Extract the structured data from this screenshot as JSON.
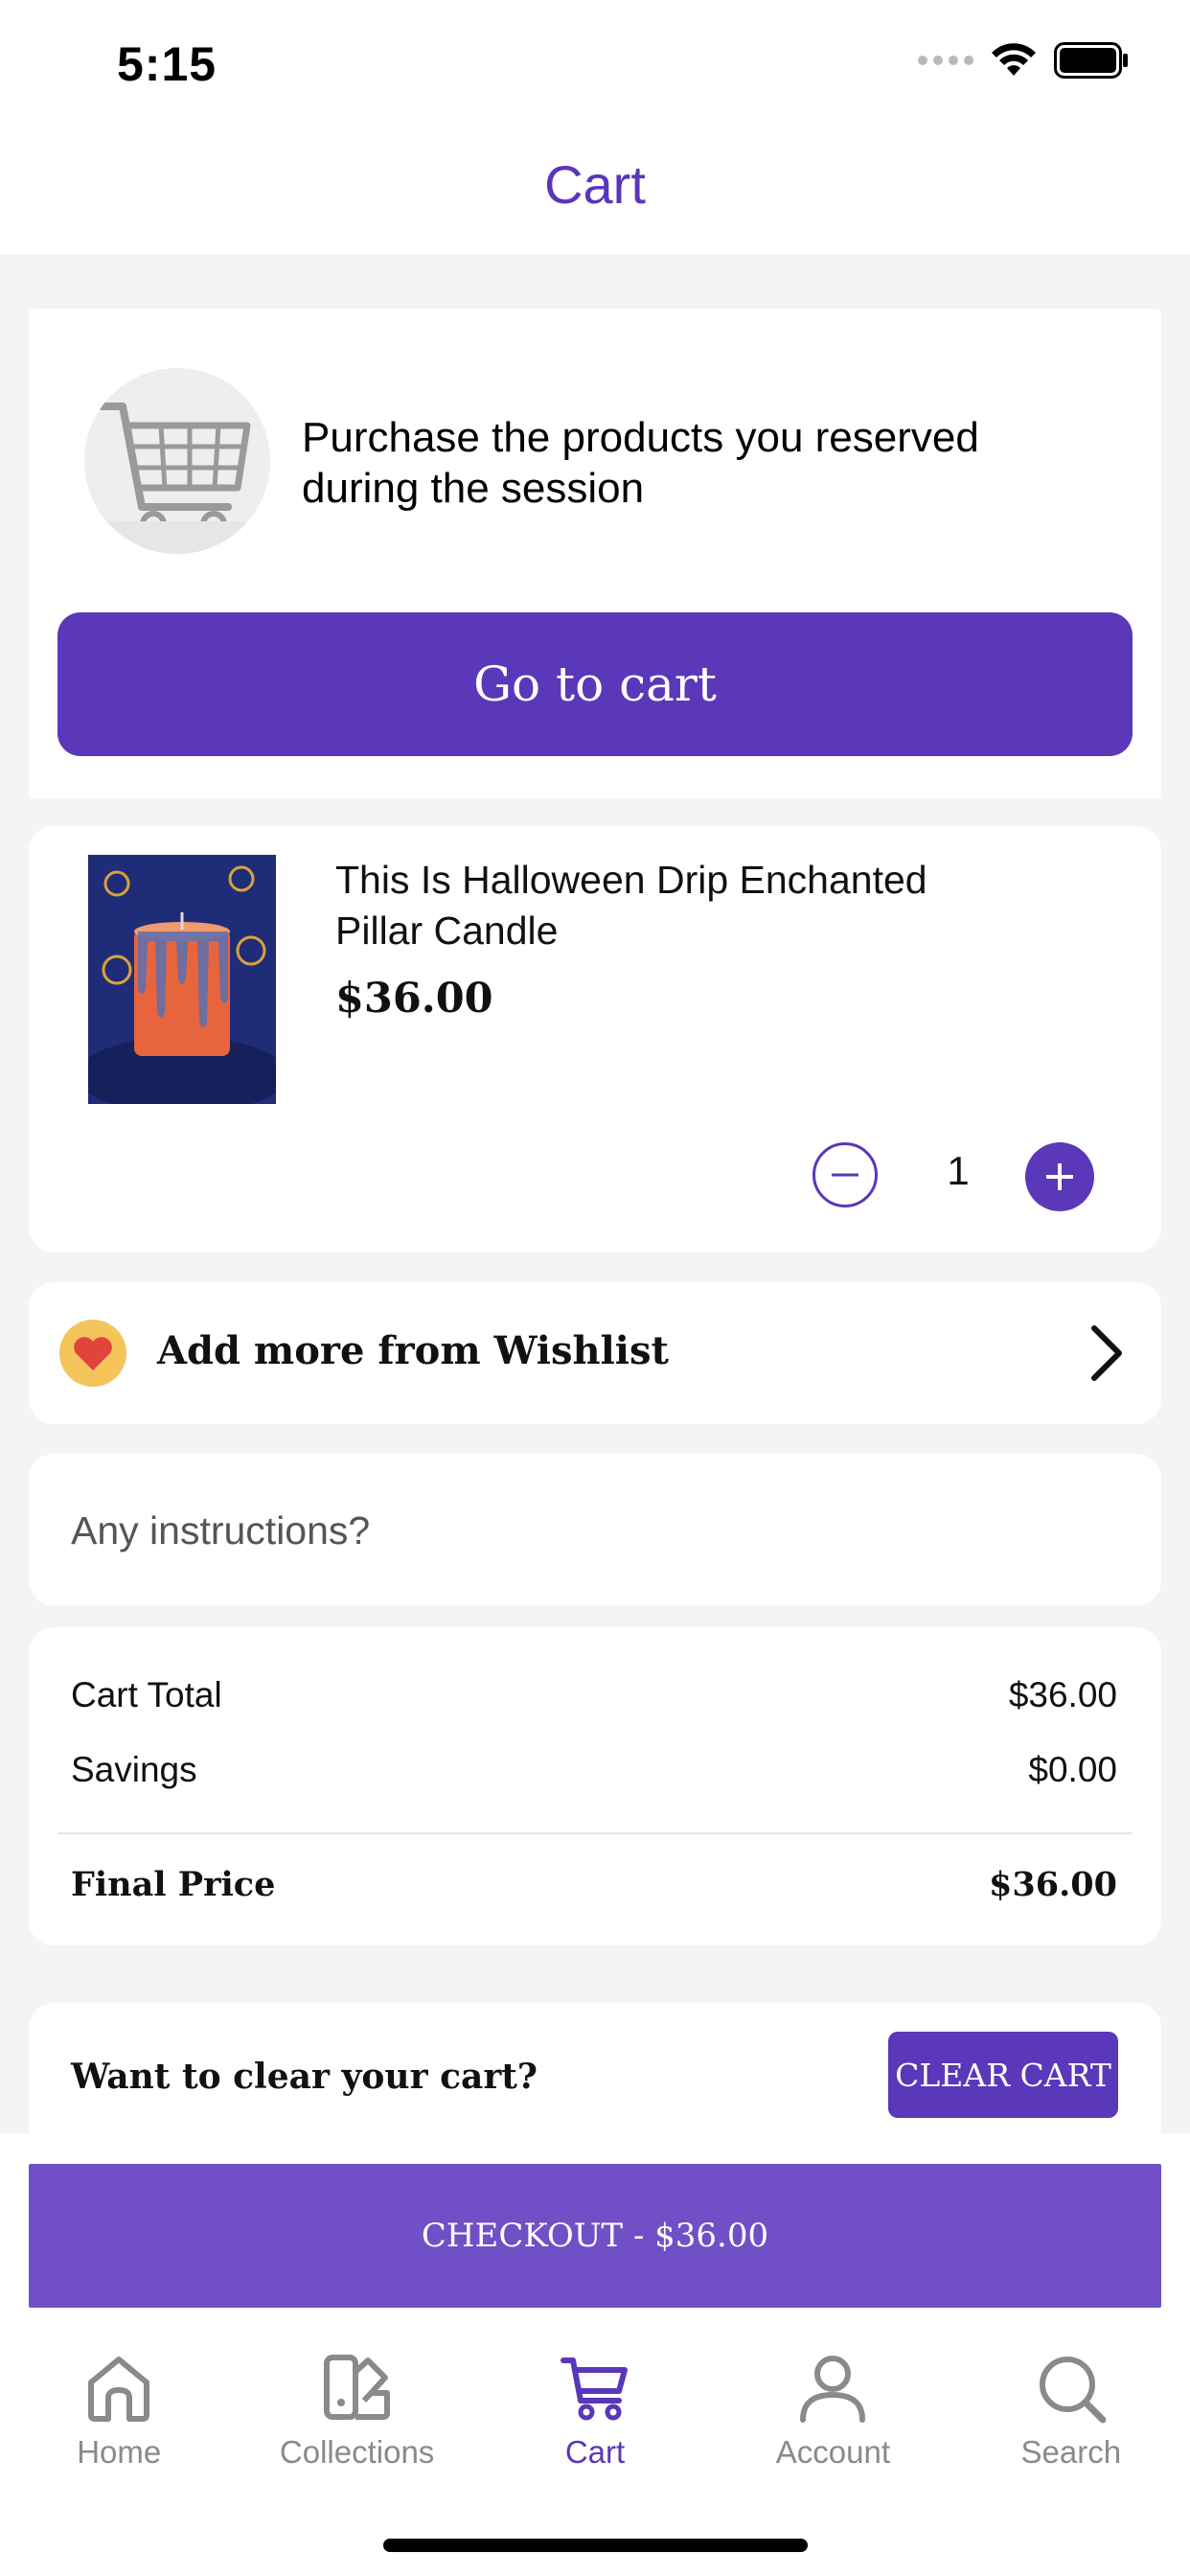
{
  "status_bar": {
    "time": "5:15"
  },
  "header": {
    "title": "Cart"
  },
  "reservation": {
    "message": "Purchase the products you reserved during the session",
    "button_label": "Go to cart"
  },
  "product": {
    "name": "This Is Halloween Drip Enchanted Pillar Candle",
    "price": "$36.00",
    "quantity": "1"
  },
  "wishlist": {
    "label": "Add more from Wishlist"
  },
  "instructions": {
    "placeholder": "Any instructions?"
  },
  "totals": {
    "cart_total_label": "Cart Total",
    "cart_total_value": "$36.00",
    "savings_label": "Savings",
    "savings_value": "$0.00",
    "final_label": "Final Price",
    "final_value": "$36.00"
  },
  "clear_cart": {
    "question": "Want to clear your cart?",
    "button_label": "CLEAR CART"
  },
  "checkout": {
    "button_label": "CHECKOUT - $36.00"
  },
  "tabbar": {
    "items": [
      {
        "label": "Home",
        "icon": "home-icon"
      },
      {
        "label": "Collections",
        "icon": "collections-icon"
      },
      {
        "label": "Cart",
        "icon": "cart-icon",
        "active": true
      },
      {
        "label": "Account",
        "icon": "account-icon"
      },
      {
        "label": "Search",
        "icon": "search-icon"
      }
    ]
  },
  "colors": {
    "accent": "#5b37b9",
    "checkout": "#714fc6",
    "background": "#f4f4f4",
    "inactive_tab": "#8a8a8a"
  }
}
